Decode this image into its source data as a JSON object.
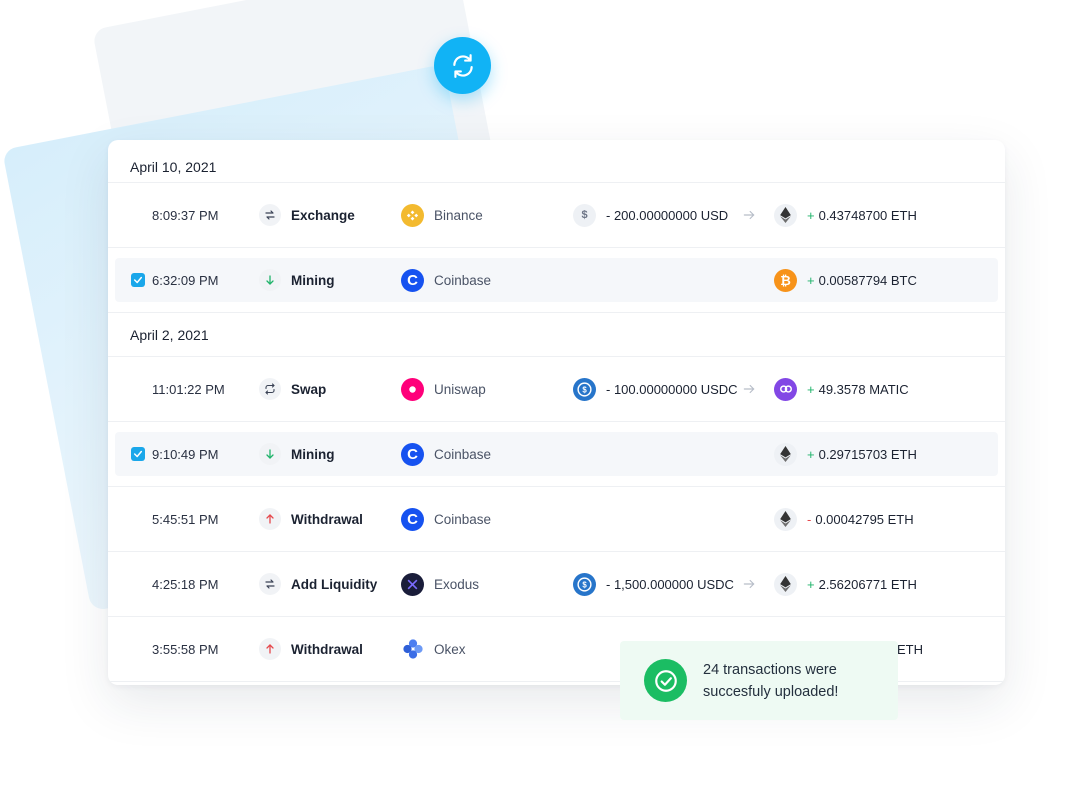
{
  "sync_button": {
    "icon": "refresh-icon",
    "color": "#11b3f5"
  },
  "groups": [
    {
      "date": "April 10, 2021",
      "rows": [
        {
          "selected": false,
          "time": "8:09:37 PM",
          "type": "Exchange",
          "type_icon": "exchange-icon",
          "source": "Binance",
          "source_icon": "binance-icon",
          "from": "- 200.00000000 USD",
          "from_icon": "usd-icon",
          "to_sign": "+",
          "to": "0.43748700 ETH",
          "to_icon": "eth-icon"
        },
        {
          "selected": true,
          "time": "6:32:09 PM",
          "type": "Mining",
          "type_icon": "arrow-down-icon",
          "source": "Coinbase",
          "source_icon": "coinbase-icon",
          "from": "",
          "from_icon": "",
          "to_sign": "+",
          "to": "0.00587794 BTC",
          "to_icon": "btc-icon"
        }
      ]
    },
    {
      "date": "April 2, 2021",
      "rows": [
        {
          "selected": false,
          "time": "11:01:22 PM",
          "type": "Swap",
          "type_icon": "swap-icon",
          "source": "Uniswap",
          "source_icon": "uniswap-icon",
          "from": "- 100.00000000 USDC",
          "from_icon": "usdc-icon",
          "to_sign": "+",
          "to": "49.3578 MATIC",
          "to_icon": "matic-icon"
        },
        {
          "selected": true,
          "time": "9:10:49 PM",
          "type": "Mining",
          "type_icon": "arrow-down-icon",
          "source": "Coinbase",
          "source_icon": "coinbase-icon",
          "from": "",
          "from_icon": "",
          "to_sign": "+",
          "to": "0.29715703 ETH",
          "to_icon": "eth-icon"
        },
        {
          "selected": false,
          "time": "5:45:51 PM",
          "type": "Withdrawal",
          "type_icon": "arrow-up-icon",
          "source": "Coinbase",
          "source_icon": "coinbase-icon",
          "from": "",
          "from_icon": "",
          "to_sign": "-",
          "to": "0.00042795 ETH",
          "to_icon": "eth-icon"
        },
        {
          "selected": false,
          "time": "4:25:18 PM",
          "type": "Add Liquidity",
          "type_icon": "exchange-icon",
          "source": "Exodus",
          "source_icon": "exodus-icon",
          "from": "- 1,500.000000 USDC",
          "from_icon": "usdc-icon",
          "to_sign": "+",
          "to": "2.56206771 ETH",
          "to_icon": "eth-icon"
        },
        {
          "selected": false,
          "time": "3:55:58 PM",
          "type": "Withdrawal",
          "type_icon": "arrow-up-icon",
          "source": "Okex",
          "source_icon": "okex-icon",
          "from": "",
          "from_icon": "",
          "to_sign": "",
          "to": "ETH",
          "to_icon": ""
        }
      ]
    }
  ],
  "toast": {
    "message": "24 transactions were succesfuly uploaded!",
    "icon": "check-circle-icon",
    "color": "#1bbd63"
  },
  "colors": {
    "accent": "#11b3f5",
    "positive": "#1fb36a",
    "negative": "#e5484d"
  }
}
